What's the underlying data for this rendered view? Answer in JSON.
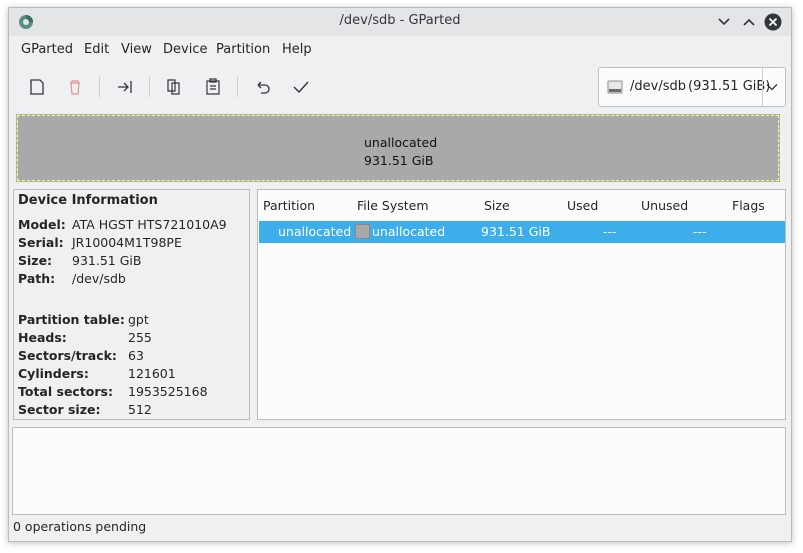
{
  "window": {
    "title": "/dev/sdb - GParted"
  },
  "menu": [
    "GParted",
    "Edit",
    "View",
    "Device",
    "Partition",
    "Help"
  ],
  "toolbar": {
    "icons": [
      "new-icon",
      "delete-icon",
      "resize-move-icon",
      "copy-icon",
      "paste-icon",
      "undo-icon",
      "apply-icon"
    ]
  },
  "device_selector": {
    "name": "/dev/sdb",
    "size": "(931.51 GiB)"
  },
  "disk_map": {
    "label": "unallocated",
    "size": "931.51 GiB",
    "colors": {
      "fill": "#a9a9a9",
      "border": "#bbbd5a"
    }
  },
  "device_info": {
    "heading": "Device Information",
    "model_label": "Model:",
    "model": "ATA HGST HTS721010A9",
    "serial_label": "Serial:",
    "serial": "JR10004M1T98PE",
    "size_label": "Size:",
    "size": "931.51 GiB",
    "path_label": "Path:",
    "path": "/dev/sdb",
    "ptable_label": "Partition table:",
    "ptable": "gpt",
    "heads_label": "Heads:",
    "heads": "255",
    "spt_label": "Sectors/track:",
    "spt": "63",
    "cyl_label": "Cylinders:",
    "cyl": "121601",
    "tsec_label": "Total sectors:",
    "tsec": "1953525168",
    "ssize_label": "Sector size:",
    "ssize": "512"
  },
  "partition_table": {
    "columns": [
      "Partition",
      "File System",
      "Size",
      "Used",
      "Unused",
      "Flags"
    ],
    "rows": [
      {
        "partition": "unallocated",
        "filesystem": "unallocated",
        "size": "931.51 GiB",
        "used": "---",
        "unused": "---",
        "flags": ""
      }
    ],
    "selection_color": "#3daee9"
  },
  "status": {
    "text": "0 operations pending"
  }
}
